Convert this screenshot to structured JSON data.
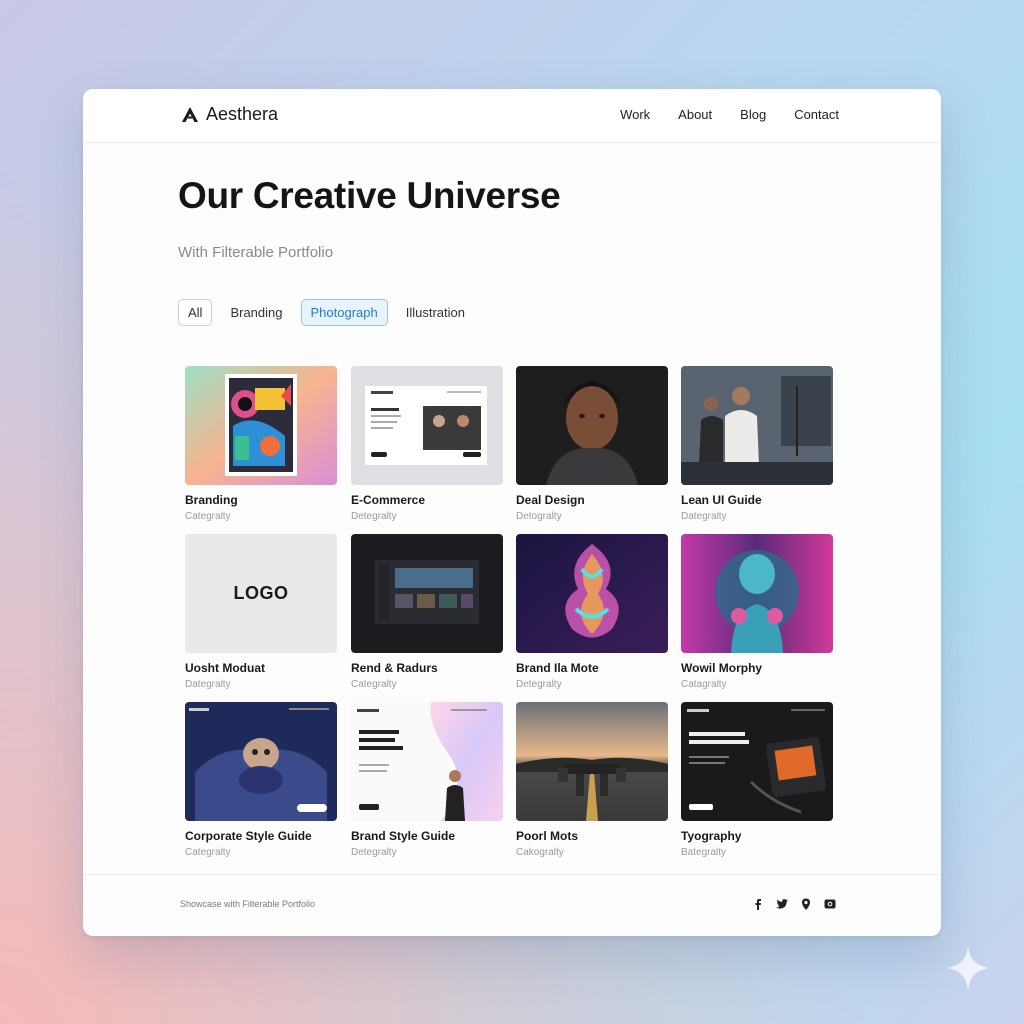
{
  "brand": {
    "name": "Aesthera",
    "logo_icon": "triangle-a-logo-icon"
  },
  "nav": {
    "links": [
      "Work",
      "About",
      "Blog",
      "Contact"
    ]
  },
  "hero": {
    "title": "Our Creative Universe",
    "subtitle": "With Filterable Portfolio"
  },
  "filters": {
    "items": [
      "All",
      "Branding",
      "Photograph",
      "Illustration"
    ],
    "active": "Photograph"
  },
  "cards": [
    {
      "title": "Branding",
      "category": "Categralty"
    },
    {
      "title": "E-Commerce",
      "category": "Detegralty"
    },
    {
      "title": "Deal Design",
      "category": "Detogralty"
    },
    {
      "title": "Lean UI Guide",
      "category": "Dategralty"
    },
    {
      "title": "Uosht Moduat",
      "category": "Dategralty",
      "thumb_text": "LOGO"
    },
    {
      "title": "Rend & Radurs",
      "category": "Categralty"
    },
    {
      "title": "Brand Ila Mote",
      "category": "Detegralty"
    },
    {
      "title": "Wowil Morphy",
      "category": "Catagralty"
    },
    {
      "title": "Corporate Style Guide",
      "category": "Categralty"
    },
    {
      "title": "Brand Style Guide",
      "category": "Detegralty"
    },
    {
      "title": "Poorl Mots",
      "category": "Cakogralty"
    },
    {
      "title": "Tyography",
      "category": "Bategralty"
    }
  ],
  "footer": {
    "text": "Showcase with Filterable Portfolio",
    "socials": [
      "facebook-icon",
      "twitter-icon",
      "location-pin-icon",
      "instagram-icon"
    ]
  },
  "colors": {
    "accent": "#1f7fc4",
    "active_filter_bg": "#e8f4fd",
    "title": "#151515"
  }
}
